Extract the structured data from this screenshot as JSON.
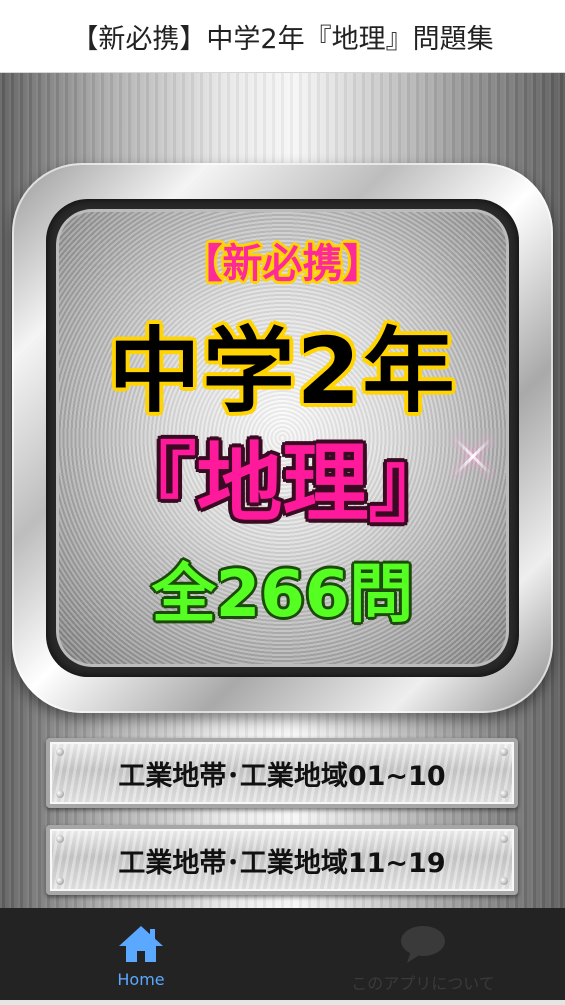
{
  "header": {
    "title": "【新必携】中学2年『地理』問題集"
  },
  "banner": {
    "brand": "【新必携】",
    "grade": "中学2年",
    "subject": "『地理』",
    "count": "全266問"
  },
  "menu": [
    {
      "label": "工業地帯･工業地域01~10"
    },
    {
      "label": "工業地帯･工業地域11~19"
    }
  ],
  "tabbar": {
    "tabs": [
      {
        "label": "Home",
        "icon": "home-icon",
        "active": true
      },
      {
        "label": "このアプリについて",
        "icon": "chat-bubble-icon",
        "active": false
      }
    ]
  },
  "colors": {
    "active_tab": "#5aa8ff",
    "inactive_tab": "#3a3a3a",
    "tabbar_bg": "#232323",
    "brand_pink": "#ff2a9a",
    "count_green": "#55ff22",
    "outline_yellow": "#ffd400"
  }
}
